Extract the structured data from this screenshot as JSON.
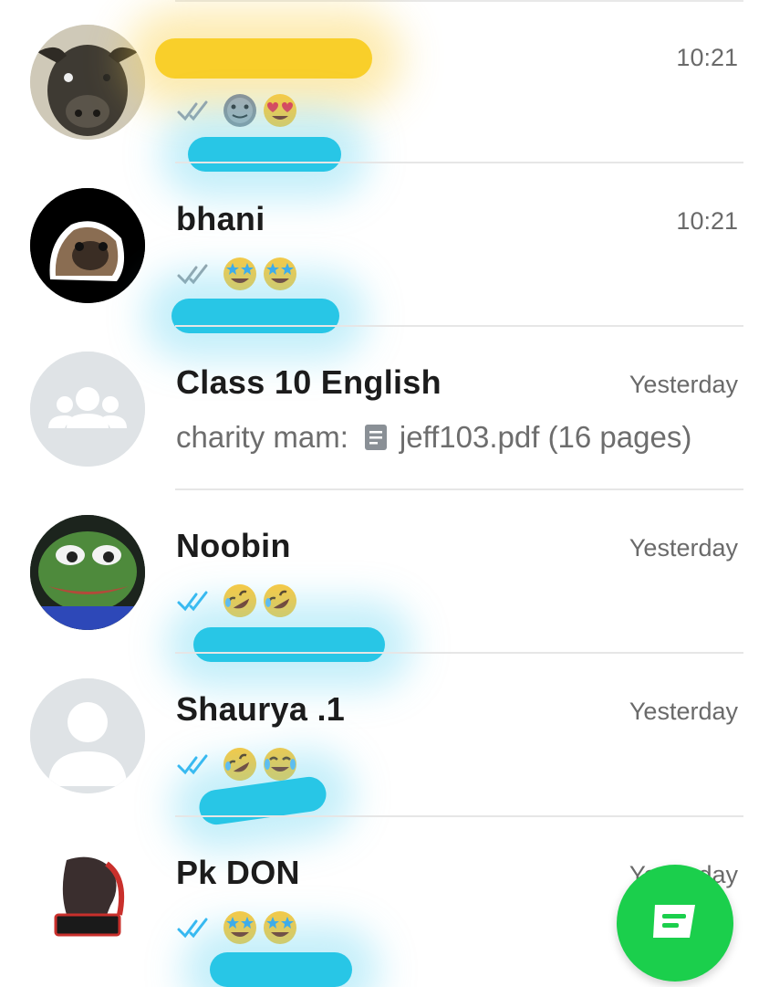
{
  "chats": [
    {
      "name": "",
      "time": "10:21",
      "ticks": "read-gray",
      "emojis": [
        "grimace-emoji",
        "heart-eyes-emoji"
      ],
      "avatar": "buffalo-photo-avatar"
    },
    {
      "name": "bhani",
      "time": "10:21",
      "ticks": "read-gray",
      "emojis": [
        "star-struck-emoji",
        "star-struck-emoji"
      ],
      "avatar": "pug-photo-avatar"
    },
    {
      "name": "Class 10 English",
      "time": "Yesterday",
      "sender": "charity mam:",
      "attachment": "jeff103.pdf (16 pages)",
      "avatar": "group-icon-avatar"
    },
    {
      "name": "Noobin",
      "time": "Yesterday",
      "ticks": "read-blue",
      "emojis": [
        "rofl-emoji",
        "rofl-emoji"
      ],
      "avatar": "frog-photo-avatar"
    },
    {
      "name": "Shaurya .1",
      "time": "Yesterday",
      "ticks": "read-blue",
      "emojis": [
        "rofl-emoji",
        "joy-emoji"
      ],
      "avatar": "default-person-avatar"
    },
    {
      "name": "Pk DON",
      "time": "Yesterday",
      "ticks": "read-blue",
      "emojis": [
        "star-struck-emoji",
        "star-struck-emoji"
      ],
      "avatar": "logo-photo-avatar"
    }
  ],
  "fab": {
    "icon": "new-chat-icon"
  },
  "colors": {
    "accent": "#1bcf4c",
    "read_blue": "#34b7f1",
    "scribble_blue": "#28c6e6",
    "scribble_yellow": "#f9cf2a"
  }
}
